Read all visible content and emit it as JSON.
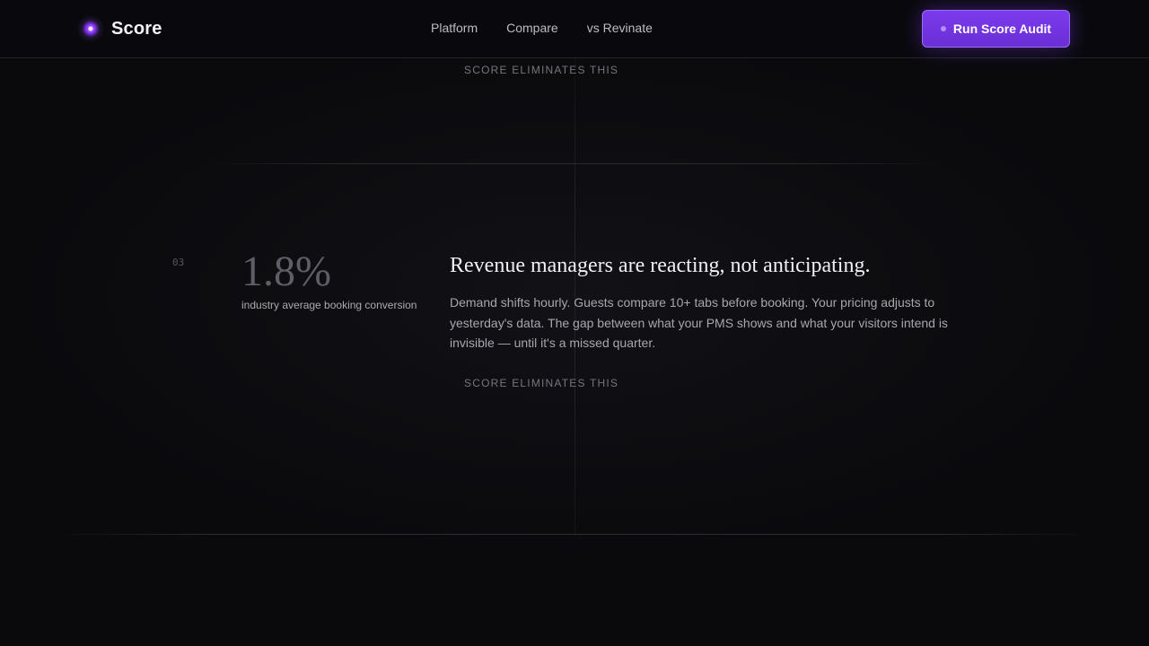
{
  "header": {
    "brand": "Score",
    "nav": [
      "Platform",
      "Compare",
      "vs Revinate"
    ],
    "cta_label": "Run Score Audit"
  },
  "section": {
    "eliminates_top": "SCORE ELIMINATES THIS",
    "index": "03",
    "stat_value": "1.8%",
    "stat_label": "industry average booking conversion",
    "headline": "Revenue managers are reacting, not anticipating.",
    "body": "Demand shifts hourly. Guests compare 10+ tabs before booking. Your pricing adjusts to yesterday's data. The gap between what your PMS shows and what your visitors intend is invisible — until it's a missed quarter.",
    "eliminates_bottom": "SCORE ELIMINATES THIS"
  },
  "colors": {
    "background": "#0a0a0d",
    "accent": "#7c3aed",
    "text_primary": "#f0f0f3",
    "text_muted": "#a6a6ae"
  },
  "icons": {
    "logo": "orb-logo-icon",
    "cta": "dot-icon"
  }
}
